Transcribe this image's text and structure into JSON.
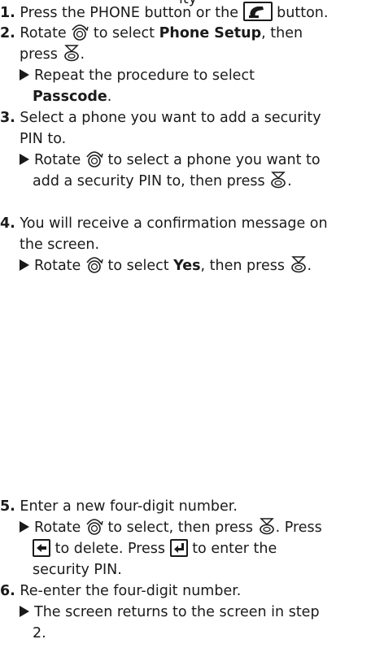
{
  "top_fragment": "ity",
  "steps": [
    {
      "num": "1.",
      "parts": [
        "Press the PHONE button or the",
        "button."
      ]
    },
    {
      "num": "2.",
      "parts": [
        "Rotate",
        "to select",
        "Phone Setup",
        ", then",
        "press",
        "."
      ],
      "sub": {
        "line1": "Repeat the procedure to select",
        "line2": "Passcode",
        "line2_end": "."
      }
    },
    {
      "num": "3.",
      "line1": "Select a phone you want to add a security",
      "line2": "PIN to.",
      "sub": {
        "a": "Rotate",
        "b": "to select a phone you want to",
        "c": "add a security PIN to, then press",
        "d": "."
      }
    },
    {
      "num": "4.",
      "line1": "You will receive a confirmation message on",
      "line2": "the screen.",
      "sub": {
        "a": "Rotate",
        "b": "to select",
        "c": "Yes",
        "d": ", then press",
        "e": "."
      }
    },
    {
      "num": "5.",
      "line1": "Enter a new four-digit number.",
      "sub": {
        "a": "Rotate",
        "b": "to select, then press",
        "c": ". Press",
        "d": "to delete. Press",
        "e": "to enter the",
        "f": "security PIN."
      }
    },
    {
      "num": "6.",
      "line1": "Re-enter the four-digit number.",
      "sub": {
        "line1": "The screen returns to the screen in step",
        "line2": "2."
      }
    }
  ],
  "icons": {
    "phone_button": "phone-icon",
    "dial": "selector-dial-icon",
    "enter": "press-enter-icon",
    "back": "back-arrow-key-icon",
    "return": "enter-return-key-icon"
  }
}
